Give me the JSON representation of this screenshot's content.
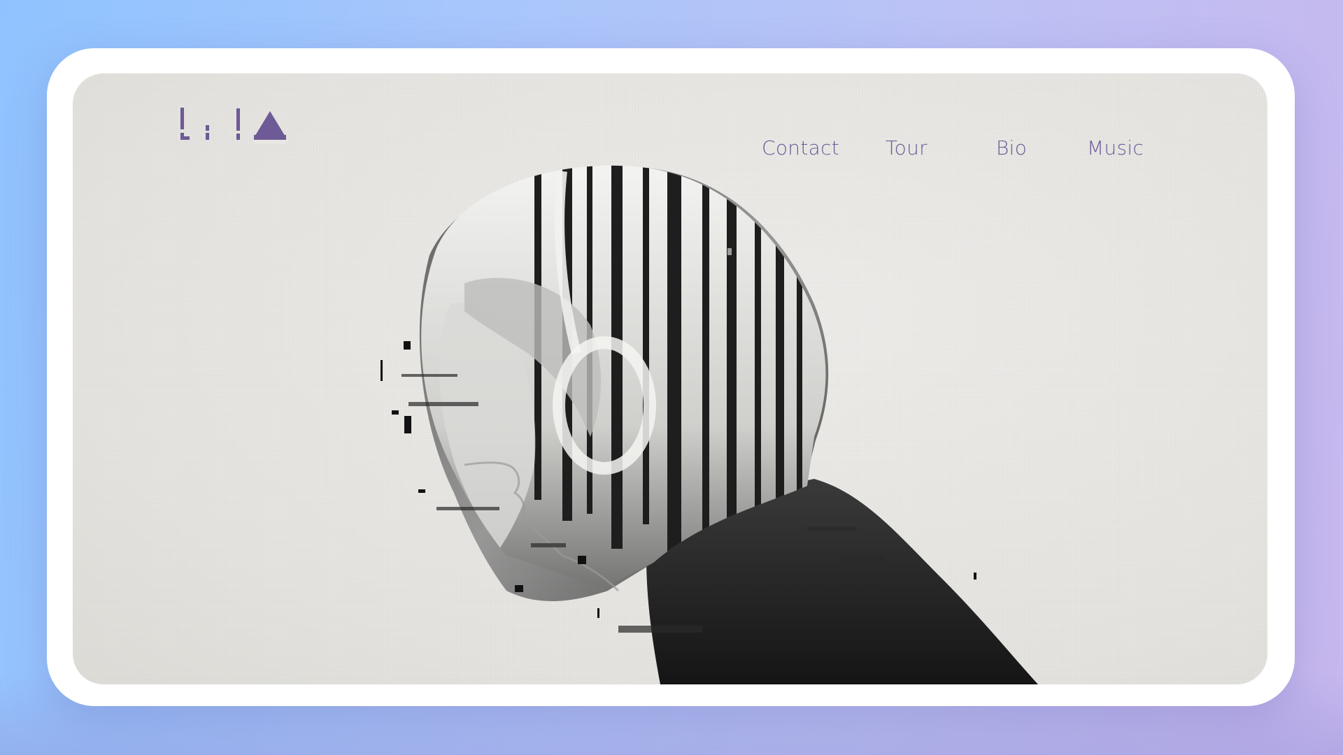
{
  "brand": {
    "logo_text": "LiLA",
    "accent_color": "#6d5a96"
  },
  "nav": {
    "items": [
      {
        "label": "Contact"
      },
      {
        "label": "Tour"
      },
      {
        "label": "Bio"
      },
      {
        "label": "Music"
      }
    ]
  },
  "hero": {
    "image_subject": "double-exposure portrait of a woman with headphones blended with a pine forest, glitch effect"
  },
  "colors": {
    "background_gradient_start": "#8fc3ff",
    "background_gradient_end": "#c8b7ee",
    "frame": "#ffffff",
    "paper": "#e9e7e3",
    "nav_text": "#6d5a96"
  }
}
